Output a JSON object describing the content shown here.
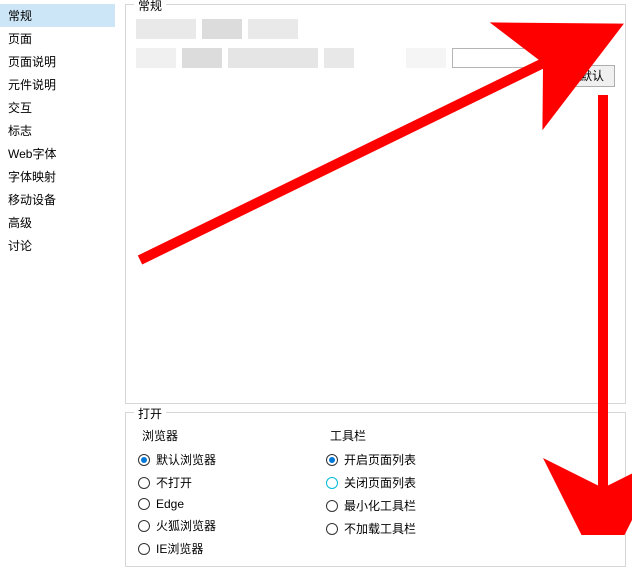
{
  "sidebar": {
    "items": [
      {
        "label": "常规",
        "selected": true
      },
      {
        "label": "页面",
        "selected": false
      },
      {
        "label": "页面说明",
        "selected": false
      },
      {
        "label": "元件说明",
        "selected": false
      },
      {
        "label": "交互",
        "selected": false
      },
      {
        "label": "标志",
        "selected": false
      },
      {
        "label": "Web字体",
        "selected": false
      },
      {
        "label": "字体映射",
        "selected": false
      },
      {
        "label": "移动设备",
        "selected": false
      },
      {
        "label": "高级",
        "selected": false
      },
      {
        "label": "讨论",
        "selected": false
      }
    ]
  },
  "main": {
    "group_general_title": "常规",
    "browse_label": "...",
    "use_default_label": "使用默认",
    "group_open_title": "打开",
    "browser_col_title": "浏览器",
    "toolbar_col_title": "工具栏",
    "browsers": [
      {
        "label": "默认浏览器",
        "checked": true
      },
      {
        "label": "不打开",
        "checked": false
      },
      {
        "label": "Edge",
        "checked": false
      },
      {
        "label": "火狐浏览器",
        "checked": false
      },
      {
        "label": "IE浏览器",
        "checked": false
      }
    ],
    "toolbars": [
      {
        "label": "开启页面列表",
        "checked": true
      },
      {
        "label": "关闭页面列表",
        "checked": false,
        "teal": true
      },
      {
        "label": "最小化工具栏",
        "checked": false
      },
      {
        "label": "不加载工具栏",
        "checked": false
      }
    ]
  },
  "annotations": {
    "arrow_color": "#ff0000"
  }
}
